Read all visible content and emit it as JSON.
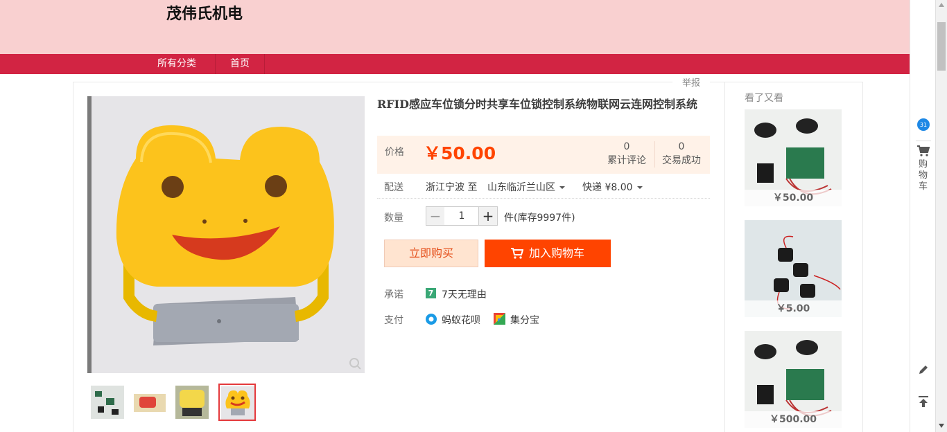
{
  "shop": {
    "name": "茂伟氏机电"
  },
  "nav": {
    "items": [
      "所有分类",
      "首页"
    ]
  },
  "report": "举报",
  "product": {
    "title": "RFID感应车位锁分时共享车位锁控制系统物联网云连网控制系统",
    "price_label": "价格",
    "currency": "￥",
    "price": "50.00",
    "stats": [
      {
        "value": "0",
        "label": "累计评论"
      },
      {
        "value": "0",
        "label": "交易成功"
      }
    ],
    "shipping": {
      "label": "配送",
      "from": "浙江宁波 至",
      "to": "山东临沂兰山区",
      "method": "快递 ¥8.00"
    },
    "quantity": {
      "label": "数量",
      "minus": "−",
      "value": "1",
      "plus": "+",
      "stock": "件(库存9997件)"
    },
    "buy_now": "立即购买",
    "add_cart": "加入购物车",
    "promise": {
      "label": "承诺",
      "badge": "7",
      "text": "7天无理由"
    },
    "payment": {
      "label": "支付",
      "methods": [
        "蚂蚁花呗",
        "集分宝"
      ]
    }
  },
  "side": {
    "title": "看了又看",
    "items": [
      {
        "price": "￥50.00"
      },
      {
        "price": "￥5.00"
      },
      {
        "price": "￥500.00"
      }
    ]
  },
  "toolbar": {
    "cart_chars": [
      "购",
      "物",
      "车"
    ],
    "badge": "31"
  },
  "colors": {
    "accent": "#ff4400",
    "nav": "#d22443",
    "header": "#f9d0d0"
  }
}
